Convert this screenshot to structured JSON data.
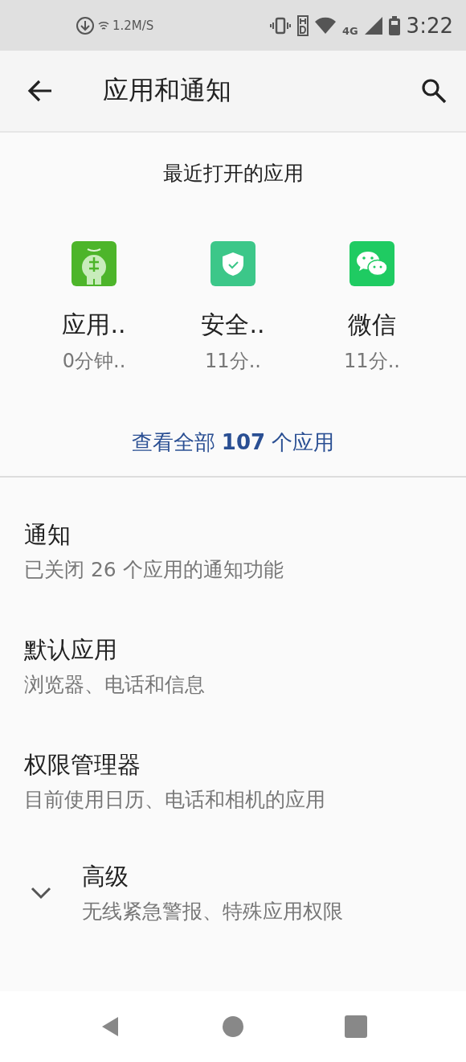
{
  "status_bar": {
    "speed": "1.2M/S",
    "network": "4G",
    "time": "3:22"
  },
  "toolbar": {
    "title": "应用和通知"
  },
  "recent_apps": {
    "title": "最近打开的应用",
    "apps": [
      {
        "name": "应用..",
        "time": "0分钟..",
        "kind": "robot"
      },
      {
        "name": "安全..",
        "time": "11分..",
        "kind": "shield"
      },
      {
        "name": "微信",
        "time": "11分..",
        "kind": "chat"
      }
    ],
    "see_all": "查看全部 **107** 个应用"
  },
  "settings": [
    {
      "kind": "plain",
      "title": "通知",
      "summary": "已关闭 26 个应用的通知功能"
    },
    {
      "kind": "plain",
      "title": "默认应用",
      "summary": "浏览器、电话和信息"
    },
    {
      "kind": "plain",
      "title": "权限管理器",
      "summary": "目前使用日历、电话和相机的应用"
    },
    {
      "kind": "expandable",
      "title": "高级",
      "summary": "无线紧急警报、特殊应用权限"
    }
  ]
}
